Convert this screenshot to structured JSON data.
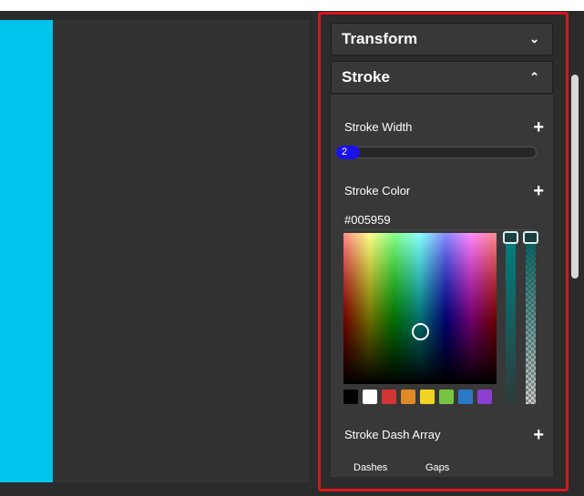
{
  "panel": {
    "transform": {
      "title": "Transform",
      "chevron": "⌄",
      "icon": "chevron-down-icon"
    },
    "stroke": {
      "title": "Stroke",
      "chevron": "⌃",
      "icon": "chevron-up-icon"
    }
  },
  "stroke_width": {
    "label": "Stroke Width",
    "value": "2",
    "add": "+"
  },
  "stroke_color": {
    "label": "Stroke Color",
    "add": "+",
    "hex": "#005959",
    "swatches": [
      "#000000",
      "#ffffff",
      "#d33535",
      "#e08a26",
      "#f0d524",
      "#77c443",
      "#2a79c8",
      "#8b3fd1"
    ]
  },
  "stroke_dash": {
    "label": "Stroke Dash Array",
    "add": "+",
    "dashes": "Dashes",
    "gaps": "Gaps"
  },
  "colors": {
    "canvas_shape": "#00c4ec",
    "highlight": "#d9161c",
    "slider_thumb": "#1a12e8"
  }
}
